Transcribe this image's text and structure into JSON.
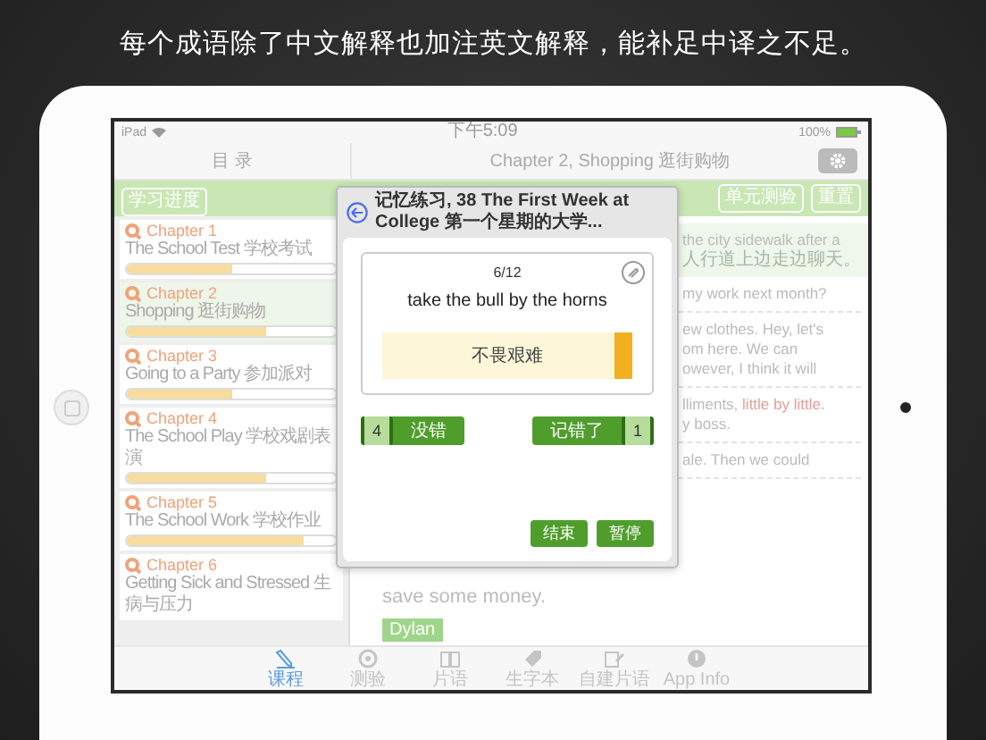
{
  "caption": "每个成语除了中文解释也加注英文解释，能补足中译之不足。",
  "status_bar": {
    "device": "iPad",
    "time": "下午5:09",
    "battery": "100%"
  },
  "sidebar": {
    "title": "目 录",
    "toolbar_button": "学习进度",
    "chapters": [
      {
        "label": "Chapter 1",
        "title": "The School Test 学校考试",
        "level": 0.5,
        "selected": false
      },
      {
        "label": "Chapter 2",
        "title": "Shopping 逛街购物",
        "level": 0.67,
        "selected": true
      },
      {
        "label": "Chapter 3",
        "title": "Going to a Party 参加派对",
        "level": 0.5,
        "selected": false
      },
      {
        "label": "Chapter 4",
        "title": "The School Play 学校戏剧表演",
        "level": 0.67,
        "selected": false
      },
      {
        "label": "Chapter 5",
        "title": "The School Work 学校作业",
        "level": 0.85,
        "selected": false
      },
      {
        "label": "Chapter 6",
        "title": "Getting Sick and Stressed 生病与压力",
        "selected": false
      }
    ]
  },
  "content": {
    "title": "Chapter 2, Shopping 逛街购物",
    "toolbar_buttons": [
      "单元测验",
      "重置"
    ],
    "blocks": [
      {
        "kind": "note",
        "lines": [
          {
            "text": "the city sidewalk after a"
          },
          {
            "text": "人行道上边走边聊天。"
          }
        ]
      },
      {
        "kind": "partial",
        "lines": [
          {
            "text": "my work next month?"
          }
        ]
      },
      {
        "kind": "partial",
        "lines": [
          {
            "text": "ew clothes. Hey, let's"
          },
          {
            "text": "om here. We can"
          },
          {
            "text": "owever, I think it will"
          }
        ]
      },
      {
        "kind": "partial",
        "lines": [
          {
            "text": "lliments, ",
            "highlight": "little by little."
          },
          {
            "text": "y boss."
          }
        ]
      },
      {
        "kind": "partial",
        "lines": [
          {
            "text": "ale. Then we could"
          }
        ]
      },
      {
        "kind": "full",
        "lines": [
          {
            "text": "save some money."
          }
        ]
      },
      {
        "kind": "tag",
        "lines": [
          {
            "text": "Dylan"
          }
        ]
      }
    ]
  },
  "dialog": {
    "title": "记忆练习, 38 The First Week at College 第一个星期的大学...",
    "counter": "6/12",
    "phrase": "take the bull by the horns",
    "answer": "不畏艰难",
    "correct": {
      "label": "没错",
      "count": "4"
    },
    "wrong": {
      "label": "记错了",
      "count": "1"
    },
    "buttons": [
      "结束",
      "暂停"
    ]
  },
  "tab_bar": [
    {
      "label": "课程",
      "selected": true
    },
    {
      "label": "测验",
      "selected": false
    },
    {
      "label": "片语",
      "selected": false
    },
    {
      "label": "生字本",
      "selected": false
    },
    {
      "label": "自建片语",
      "selected": false
    },
    {
      "label": "App Info",
      "selected": false
    }
  ]
}
